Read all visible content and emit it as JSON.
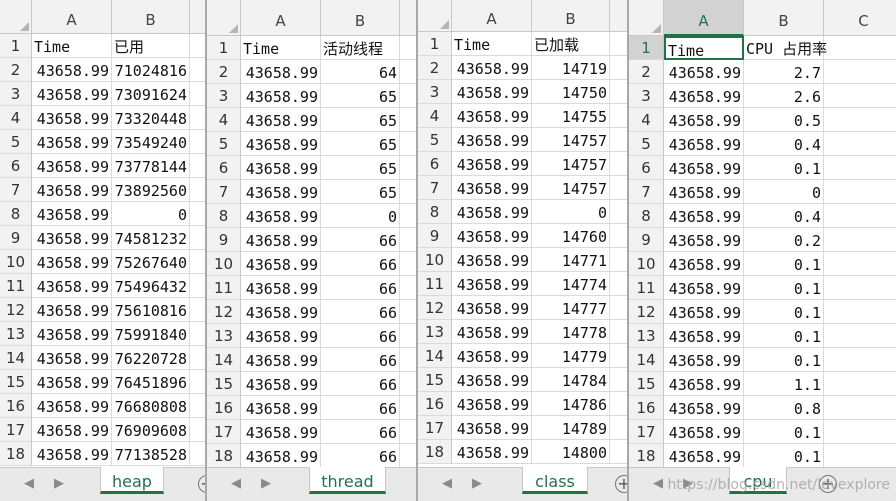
{
  "panes": [
    {
      "sheet_tab": "heap",
      "col_headers": [
        "A",
        "B"
      ],
      "rows": [
        [
          "1",
          "Time",
          "已用"
        ],
        [
          "2",
          "43658.99",
          "71024816"
        ],
        [
          "3",
          "43658.99",
          "73091624"
        ],
        [
          "4",
          "43658.99",
          "73320448"
        ],
        [
          "5",
          "43658.99",
          "73549240"
        ],
        [
          "6",
          "43658.99",
          "73778144"
        ],
        [
          "7",
          "43658.99",
          "73892560"
        ],
        [
          "8",
          "43658.99",
          "0"
        ],
        [
          "9",
          "43658.99",
          "74581232"
        ],
        [
          "10",
          "43658.99",
          "75267640"
        ],
        [
          "11",
          "43658.99",
          "75496432"
        ],
        [
          "12",
          "43658.99",
          "75610816"
        ],
        [
          "13",
          "43658.99",
          "75991840"
        ],
        [
          "14",
          "43658.99",
          "76220728"
        ],
        [
          "15",
          "43658.99",
          "76451896"
        ],
        [
          "16",
          "43658.99",
          "76680808"
        ],
        [
          "17",
          "43658.99",
          "76909608"
        ],
        [
          "18",
          "43658.99",
          "77138528"
        ]
      ]
    },
    {
      "sheet_tab": "thread",
      "col_headers": [
        "A",
        "B"
      ],
      "rows": [
        [
          "1",
          "Time",
          "活动线程"
        ],
        [
          "2",
          "43658.99",
          "64"
        ],
        [
          "3",
          "43658.99",
          "65"
        ],
        [
          "4",
          "43658.99",
          "65"
        ],
        [
          "5",
          "43658.99",
          "65"
        ],
        [
          "6",
          "43658.99",
          "65"
        ],
        [
          "7",
          "43658.99",
          "65"
        ],
        [
          "8",
          "43658.99",
          "0"
        ],
        [
          "9",
          "43658.99",
          "66"
        ],
        [
          "10",
          "43658.99",
          "66"
        ],
        [
          "11",
          "43658.99",
          "66"
        ],
        [
          "12",
          "43658.99",
          "66"
        ],
        [
          "13",
          "43658.99",
          "66"
        ],
        [
          "14",
          "43658.99",
          "66"
        ],
        [
          "15",
          "43658.99",
          "66"
        ],
        [
          "16",
          "43658.99",
          "66"
        ],
        [
          "17",
          "43658.99",
          "66"
        ],
        [
          "18",
          "43658.99",
          "66"
        ]
      ]
    },
    {
      "sheet_tab": "class",
      "col_headers": [
        "A",
        "B"
      ],
      "rows": [
        [
          "1",
          "Time",
          "已加载"
        ],
        [
          "2",
          "43658.99",
          "14719"
        ],
        [
          "3",
          "43658.99",
          "14750"
        ],
        [
          "4",
          "43658.99",
          "14755"
        ],
        [
          "5",
          "43658.99",
          "14757"
        ],
        [
          "6",
          "43658.99",
          "14757"
        ],
        [
          "7",
          "43658.99",
          "14757"
        ],
        [
          "8",
          "43658.99",
          "0"
        ],
        [
          "9",
          "43658.99",
          "14760"
        ],
        [
          "10",
          "43658.99",
          "14771"
        ],
        [
          "11",
          "43658.99",
          "14774"
        ],
        [
          "12",
          "43658.99",
          "14777"
        ],
        [
          "13",
          "43658.99",
          "14778"
        ],
        [
          "14",
          "43658.99",
          "14779"
        ],
        [
          "15",
          "43658.99",
          "14784"
        ],
        [
          "16",
          "43658.99",
          "14786"
        ],
        [
          "17",
          "43658.99",
          "14789"
        ],
        [
          "18",
          "43658.99",
          "14800"
        ]
      ]
    },
    {
      "sheet_tab": "cpu",
      "col_headers": [
        "A",
        "B",
        "C"
      ],
      "rows": [
        [
          "1",
          "Time",
          "CPU 占用率"
        ],
        [
          "2",
          "43658.99",
          "2.7"
        ],
        [
          "3",
          "43658.99",
          "2.6"
        ],
        [
          "4",
          "43658.99",
          "0.5"
        ],
        [
          "5",
          "43658.99",
          "0.4"
        ],
        [
          "6",
          "43658.99",
          "0.1"
        ],
        [
          "7",
          "43658.99",
          "0"
        ],
        [
          "8",
          "43658.99",
          "0.4"
        ],
        [
          "9",
          "43658.99",
          "0.2"
        ],
        [
          "10",
          "43658.99",
          "0.1"
        ],
        [
          "11",
          "43658.99",
          "0.1"
        ],
        [
          "12",
          "43658.99",
          "0.1"
        ],
        [
          "13",
          "43658.99",
          "0.1"
        ],
        [
          "14",
          "43658.99",
          "0.1"
        ],
        [
          "15",
          "43658.99",
          "1.1"
        ],
        [
          "16",
          "43658.99",
          "0.8"
        ],
        [
          "17",
          "43658.99",
          "0.1"
        ],
        [
          "18",
          "43658.99",
          "0.1"
        ]
      ]
    }
  ],
  "watermark": "https://blog.csdn.net/lovexplore",
  "nav": {
    "prev": "◀",
    "next": "▶"
  },
  "add_sheet": "+"
}
